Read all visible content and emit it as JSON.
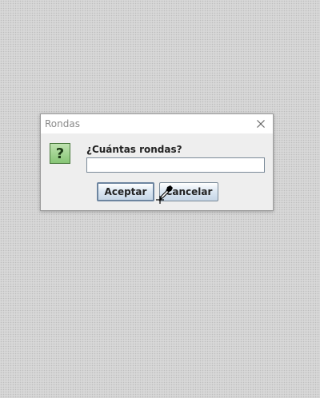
{
  "dialog": {
    "title": "Rondas",
    "prompt": "¿Cuántas rondas?",
    "input_value": "",
    "accept_label": "Aceptar",
    "cancel_label": "Cancelar",
    "question_glyph": "?",
    "icon": "question-icon",
    "close_icon": "close-icon"
  },
  "cursor": {
    "icon": "drag-pointer-icon"
  },
  "colors": {
    "desktop_background": "#d3d3d3",
    "dialog_background": "#eeeeee",
    "icon_green": "#86c575",
    "button_top": "#ffffff",
    "button_bottom": "#c6d6e6"
  }
}
